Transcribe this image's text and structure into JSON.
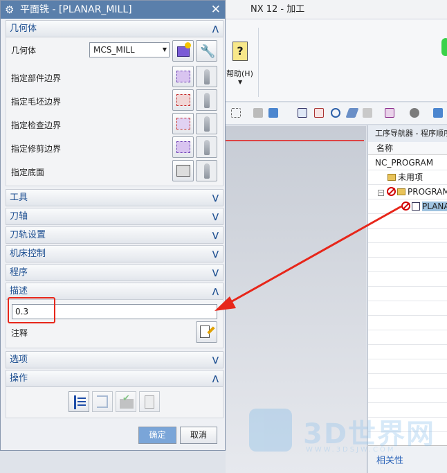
{
  "app": {
    "title": "NX 12 - 加工"
  },
  "ribbon": {
    "help_label": "帮助(H)"
  },
  "dialog": {
    "title": "平面铣 - [PLANAR_MILL]",
    "sections": {
      "geometry": "几何体",
      "tool": "工具",
      "tool_axis": "刀轴",
      "path_settings": "刀轨设置",
      "machine_control": "机床控制",
      "program": "程序",
      "description": "描述",
      "options": "选项",
      "actions": "操作"
    },
    "geometry": {
      "geometry_label": "几何体",
      "geometry_value": "MCS_MILL",
      "rows": [
        "指定部件边界",
        "指定毛坯边界",
        "指定检查边界",
        "指定修剪边界",
        "指定底面"
      ]
    },
    "description": {
      "value": "0.3",
      "note_label": "注释"
    },
    "buttons": {
      "ok": "确定",
      "cancel": "取消"
    }
  },
  "navigator": {
    "title": "工序导航器 - 程序顺序",
    "column_header": "名称",
    "rows": [
      {
        "name": "NC_PROGRAM"
      },
      {
        "name": "未用项"
      },
      {
        "name": "PROGRAM"
      },
      {
        "name": "PLANAR_MILL"
      }
    ],
    "related_label": "相关性"
  },
  "watermark": {
    "text": "3D世界网",
    "url": "WWW.3DSJW.COM"
  },
  "colors": {
    "title_bar": "#5a7fab",
    "section_text": "#1d4f91",
    "annotation": "#e7261a",
    "ok_button": "#7aa5d8"
  }
}
